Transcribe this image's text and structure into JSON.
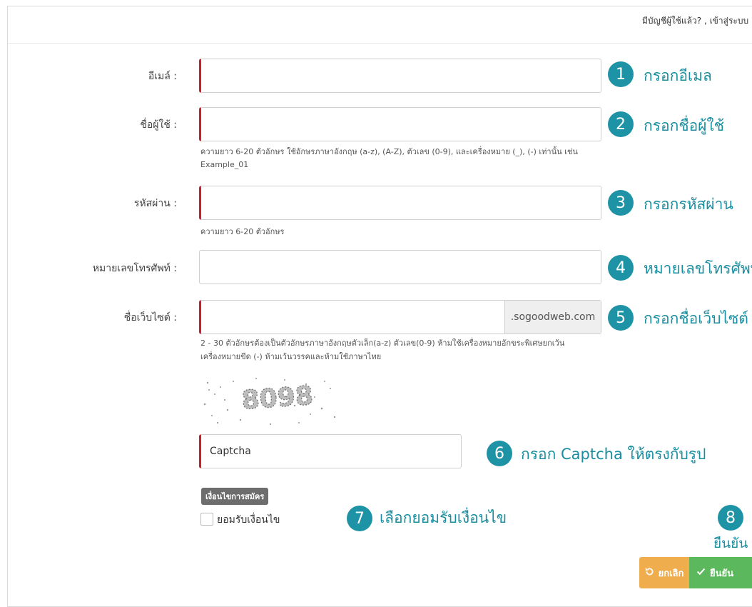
{
  "header": {
    "login_prompt": "มีบัญชีผู้ใช้แล้ว? , เข้าสู่ระบบ"
  },
  "form": {
    "email": {
      "label": "อีเมล์ :",
      "value": ""
    },
    "username": {
      "label": "ชื่อผู้ใช้ :",
      "value": "",
      "help_line1": "ความยาว 6-20 ตัวอักษร ใช้อักษรภาษาอังกฤษ (a-z), (A-Z), ตัวเลข (0-9), และเครื่องหมาย (_), (-) เท่านั้น เช่น",
      "help_line2": "Example_01"
    },
    "password": {
      "label": "รหัสผ่าน :",
      "value": "",
      "help": "ความยาว 6-20 ตัวอักษร"
    },
    "phone": {
      "label": "หมายเลขโทรศัพท์ :",
      "value": ""
    },
    "website": {
      "label": "ชื่อเว็บไซต์ :",
      "value": "",
      "suffix": ".sogoodweb.com",
      "help_line1": "2 - 30 ตัวอักษรต้องเป็นตัวอักษรภาษาอังกฤษตัวเล็ก(a-z) ตัวเลข(0-9) ห้ามใช้เครื่องหมายอักขระพิเศษยกเว้น",
      "help_line2": "เครื่องหมายขีด (-) ห้ามเว้นวรรคและห้ามใช้ภาษาไทย"
    },
    "captcha": {
      "image_text": "8098",
      "value": "Captcha"
    },
    "terms": {
      "badge": "เงื่อนไขการสมัคร",
      "checkbox_label": "ยอมรับเงื่อนไข",
      "checked": false
    }
  },
  "buttons": {
    "cancel": "ยกเลิก",
    "confirm": "ยืนยัน"
  },
  "annotations": [
    {
      "num": "1",
      "text": "กรอกอีเมล"
    },
    {
      "num": "2",
      "text": "กรอกชื่อผู้ใช้"
    },
    {
      "num": "3",
      "text": "กรอกรหัสผ่าน"
    },
    {
      "num": "4",
      "text": "หมายเลขโทรศัพท์"
    },
    {
      "num": "5",
      "text": "กรอกชื่อเว็บไซต์"
    },
    {
      "num": "6",
      "text": "กรอก Captcha ให้ตรงกับรูป"
    },
    {
      "num": "7",
      "text": "เลือกยอมรับเงื่อนไข"
    },
    {
      "num": "8",
      "text": "ยืนยัน"
    }
  ],
  "colors": {
    "annotation": "#1f93a6",
    "required_border": "#c8202e",
    "cancel_button": "#f0ad4e",
    "confirm_button": "#5cb85c"
  }
}
